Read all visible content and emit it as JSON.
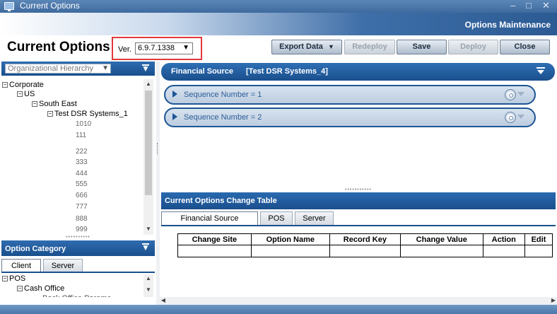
{
  "window": {
    "title": "Current Options",
    "controls": [
      "–",
      "□",
      "✕"
    ]
  },
  "header": {
    "subtitle": "Options Maintenance",
    "page_title": "Current Options"
  },
  "version": {
    "label": "Ver.",
    "selected": "6.9.7.1338"
  },
  "toolbar": {
    "export_label": "Export Data",
    "redeploy_label": "Redeploy",
    "save_label": "Save",
    "deploy_label": "Deploy",
    "close_label": "Close"
  },
  "hierarchy": {
    "select_placeholder": "Organizational Hierarchy",
    "tree": {
      "corporate": "Corporate",
      "us": "US",
      "south_east": "South East",
      "store": "Test DSR Systems_1",
      "leaves": [
        "1010",
        "111",
        "222",
        "333",
        "444",
        "555",
        "666",
        "777",
        "888",
        "999"
      ]
    }
  },
  "option_category": {
    "title": "Option Category",
    "tabs": [
      "Client",
      "Server"
    ],
    "tree": {
      "pos": "POS",
      "cash_office": "Cash Office",
      "partial": "Back Office Parame..."
    }
  },
  "financial": {
    "label": "Financial Source",
    "system": "[Test DSR Systems_4]",
    "sequences": [
      "Sequence Number = 1",
      "Sequence Number = 2"
    ]
  },
  "change_table": {
    "title": "Current Options Change Table",
    "tabs": [
      "Financial Source",
      "POS",
      "Server"
    ],
    "columns": [
      "Change Site",
      "Option Name",
      "Record Key",
      "Change Value",
      "Action",
      "Edit"
    ]
  },
  "colors": {
    "accent": "#1a4f8d",
    "highlight_box": "#e03a3a"
  }
}
